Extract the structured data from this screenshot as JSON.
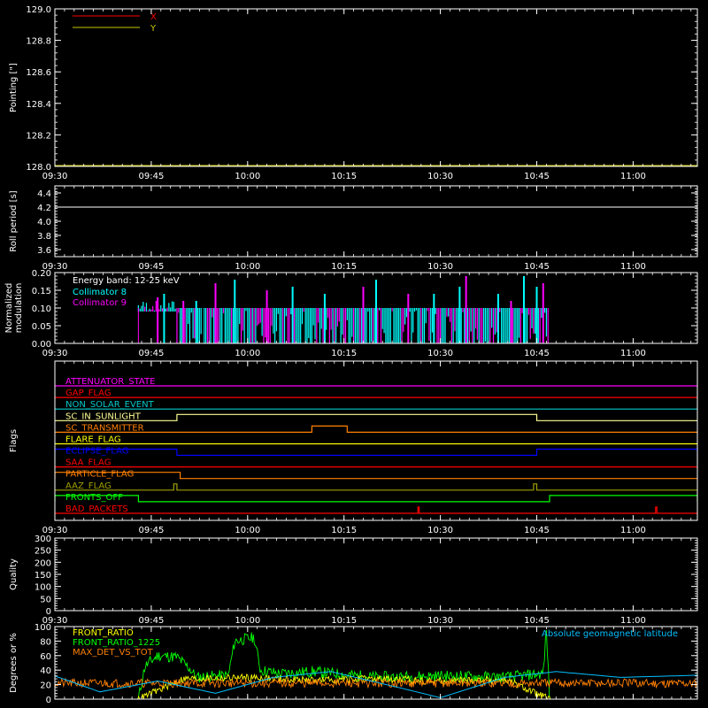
{
  "colors": {
    "background": "#000000",
    "axis": "#ffffff",
    "x_pointing": "#ff0000",
    "y_pointing": "#c8c800",
    "roll": "#ffffff",
    "collimator8": "#00ffff",
    "collimator9": "#ff00ff",
    "front_ratio": "#ffff00",
    "front_ratio_1225": "#00ff00",
    "max_det": "#ff8000",
    "geomag": "#00bfff"
  },
  "time_axis": {
    "range_minutes_after_0930": [
      0,
      100
    ],
    "tick_labels": [
      "09:30",
      "09:45",
      "10:00",
      "10:15",
      "10:30",
      "10:45",
      "11:00"
    ],
    "tick_minutes": [
      0,
      15,
      30,
      45,
      60,
      75,
      90
    ]
  },
  "chart_data": [
    {
      "id": "pointing",
      "type": "line",
      "ylabel": "Pointing [\"]",
      "ylim": [
        128.0,
        129.0
      ],
      "y_tick_labels": [
        "128.0",
        "128.2",
        "128.4",
        "128.6",
        "128.8",
        "129.0"
      ],
      "y_tick_values": [
        128.0,
        128.2,
        128.4,
        128.6,
        128.8,
        129.0
      ],
      "legend": [
        {
          "name": "X",
          "color": "#ff0000"
        },
        {
          "name": "Y",
          "color": "#c8c800"
        }
      ],
      "series": [
        {
          "name": "X",
          "x": [
            0,
            100
          ],
          "y": [
            128.0,
            128.0
          ]
        },
        {
          "name": "Y",
          "x": [
            0,
            100
          ],
          "y": [
            128.0,
            128.0
          ]
        }
      ]
    },
    {
      "id": "roll",
      "type": "line",
      "ylabel": "Roll period [s]",
      "ylim": [
        3.5,
        4.5
      ],
      "y_tick_labels": [
        "3.6",
        "3.8",
        "4.0",
        "4.2",
        "4.4"
      ],
      "y_tick_values": [
        3.6,
        3.8,
        4.0,
        4.2,
        4.4
      ],
      "series": [
        {
          "name": "roll",
          "x": [
            0,
            100
          ],
          "y": [
            4.2,
            4.2
          ]
        }
      ]
    },
    {
      "id": "modulation",
      "type": "line",
      "ylabel_lines": [
        "Normalized",
        "modulation"
      ],
      "ylim": [
        0,
        0.2
      ],
      "y_tick_labels": [
        "0.00",
        "0.05",
        "0.10",
        "0.15",
        "0.20"
      ],
      "y_tick_values": [
        0,
        0.05,
        0.1,
        0.15,
        0.2
      ],
      "annotation": "Energy band: 12-25 keV",
      "legend": [
        {
          "name": "Collimator 8",
          "color": "#00ffff"
        },
        {
          "name": "Collimator 9",
          "color": "#ff00ff"
        }
      ],
      "data_range_minutes": [
        13,
        77
      ],
      "typical_level": 0.1,
      "series": [
        {
          "name": "Collimator 8",
          "spikes": [
            [
              17,
              0.14
            ],
            [
              22,
              0.12
            ],
            [
              28,
              0.18
            ],
            [
              37,
              0.16
            ],
            [
              42,
              0.14
            ],
            [
              50,
              0.18
            ],
            [
              59,
              0.14
            ],
            [
              63,
              0.16
            ],
            [
              69,
              0.14
            ],
            [
              73,
              0.19
            ],
            [
              75,
              0.16
            ]
          ]
        },
        {
          "name": "Collimator 9",
          "spikes": [
            [
              16,
              0.13
            ],
            [
              20,
              0.12
            ],
            [
              25,
              0.17
            ],
            [
              33,
              0.15
            ],
            [
              48,
              0.16
            ],
            [
              55,
              0.14
            ],
            [
              64,
              0.19
            ],
            [
              71,
              0.12
            ],
            [
              76,
              0.17
            ]
          ]
        }
      ]
    },
    {
      "id": "flags",
      "type": "line",
      "ylabel": "Flags",
      "flags": [
        {
          "name": "ATTENUATOR_STATE",
          "color": "#ff00ff",
          "on": []
        },
        {
          "name": "GAP_FLAG",
          "color": "#ff0000",
          "on": []
        },
        {
          "name": "NON_SOLAR_EVENT",
          "color": "#00c8c8",
          "on": []
        },
        {
          "name": "SC_IN_SUNLIGHT",
          "color": "#ffff96",
          "on": [
            [
              19,
              75
            ]
          ]
        },
        {
          "name": "SC_TRANSMITTER",
          "color": "#ff8000",
          "on": [
            [
              40,
              45.5
            ]
          ]
        },
        {
          "name": "FLARE_FLAG",
          "color": "#ffff00",
          "on": []
        },
        {
          "name": "ECLIPSE_FLAG",
          "color": "#0000ff",
          "on": [
            [
              0,
              19
            ],
            [
              75,
              100
            ]
          ]
        },
        {
          "name": "SAA_FLAG",
          "color": "#ff0000",
          "on": []
        },
        {
          "name": "PARTICLE_FLAG",
          "color": "#ff8000",
          "on": [
            [
              0,
              19.5
            ]
          ]
        },
        {
          "name": "AAZ_FLAG",
          "color": "#a0a000",
          "on": [
            [
              18.5,
              19
            ],
            [
              74.5,
              75
            ]
          ]
        },
        {
          "name": "FRONTS_OFF",
          "color": "#00ff00",
          "on": [
            [
              0,
              13
            ],
            [
              77,
              100
            ]
          ]
        },
        {
          "name": "BAD_PACKETS",
          "color": "#ff0000",
          "on": [
            [
              56.5,
              56.7
            ],
            [
              93.5,
              93.7
            ]
          ]
        }
      ]
    },
    {
      "id": "quality",
      "type": "line",
      "ylabel": "Quality",
      "ylim": [
        0,
        300
      ],
      "y_tick_labels": [
        "0",
        "50",
        "100",
        "150",
        "200",
        "250",
        "300"
      ],
      "y_tick_values": [
        0,
        50,
        100,
        150,
        200,
        250,
        300
      ],
      "series": []
    },
    {
      "id": "ratios",
      "type": "line",
      "ylabel": "Degrees or %",
      "ylim": [
        0,
        100
      ],
      "y_tick_labels": [
        "0",
        "20",
        "40",
        "60",
        "80",
        "100"
      ],
      "y_tick_values": [
        0,
        20,
        40,
        60,
        80,
        100
      ],
      "legend": [
        {
          "name": "FRONT_RATIO",
          "color": "#ffff00"
        },
        {
          "name": "FRONT_RATIO_1225",
          "color": "#00ff00"
        },
        {
          "name": "MAX_DET_VS_TOT",
          "color": "#ff8000"
        }
      ],
      "annotation": "Absolute geomagnetic latitude",
      "series": [
        {
          "name": "FRONT_RATIO_1225",
          "x": [
            0,
            13,
            14,
            16,
            19,
            21,
            22,
            27,
            28,
            31,
            32,
            35,
            40,
            50,
            60,
            70,
            76,
            76.5,
            77,
            80,
            90,
            100
          ],
          "y": [
            0,
            0,
            45,
            60,
            58,
            42,
            30,
            33,
            80,
            85,
            40,
            35,
            38,
            30,
            32,
            30,
            35,
            95,
            0,
            0,
            0,
            0
          ],
          "noise": 8
        },
        {
          "name": "FRONT_RATIO",
          "x": [
            0,
            13,
            20,
            30,
            40,
            50,
            60,
            70,
            77,
            100
          ],
          "y": [
            0,
            0,
            28,
            30,
            26,
            28,
            25,
            27,
            0,
            0
          ],
          "noise": 5
        },
        {
          "name": "MAX_DET_VS_TOT",
          "x": [
            0,
            100
          ],
          "y": [
            22,
            22
          ],
          "noise": 6
        },
        {
          "name": "Absolute geomagnetic latitude",
          "x": [
            0,
            7,
            16,
            25,
            34,
            43,
            54,
            60,
            70,
            78,
            88,
            100
          ],
          "y": [
            32,
            10,
            25,
            8,
            30,
            38,
            15,
            2,
            30,
            38,
            30,
            33
          ],
          "noise": 0
        }
      ]
    }
  ]
}
